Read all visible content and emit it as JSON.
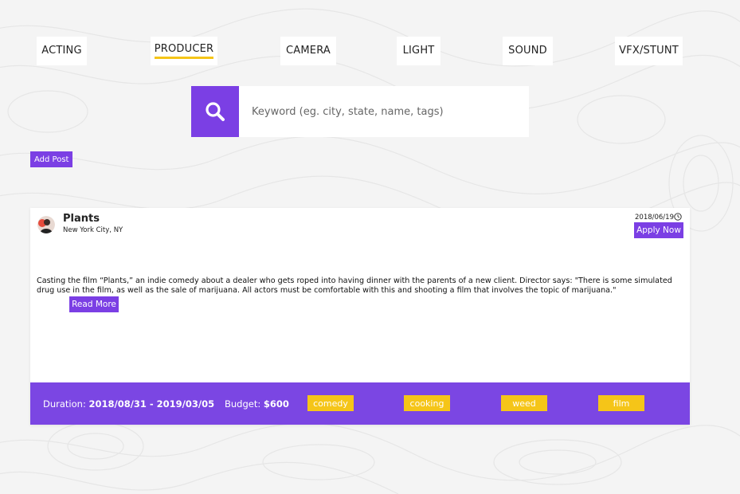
{
  "tabs": [
    {
      "label": "ACTING",
      "active": false
    },
    {
      "label": "PRODUCER",
      "active": true
    },
    {
      "label": "CAMERA",
      "active": false
    },
    {
      "label": "LIGHT",
      "active": false
    },
    {
      "label": "SOUND",
      "active": false
    },
    {
      "label": "VFX/STUNT",
      "active": false
    }
  ],
  "search": {
    "placeholder": "Keyword (eg. city, state, name, tags)",
    "icon": "search-icon"
  },
  "add_post_label": "Add Post",
  "post": {
    "title": "Plants",
    "location": "New York City, NY",
    "date": "2018/06/19",
    "apply_label": "Apply Now",
    "description": "Casting the film “Plants,” an indie comedy about a dealer who gets roped into having dinner with the parents of a new client. Director says: \"There is some simulated drug use in the film, as well as the sale of marijuana. All actors must be comfortable with this and shooting a film that involves the topic of marijuana.\"",
    "read_more_label": "Read More",
    "duration_label": "Duration:",
    "duration_value": "2018/08/31 - 2019/03/05",
    "budget_label": "Budget:",
    "budget_value": "$600",
    "tags": [
      "comedy",
      "cooking",
      "weed",
      "film"
    ]
  },
  "colors": {
    "accent": "#7b3fe4",
    "footer": "#7b46e3",
    "tag": "#f5c518",
    "background": "#f4f4f4"
  }
}
